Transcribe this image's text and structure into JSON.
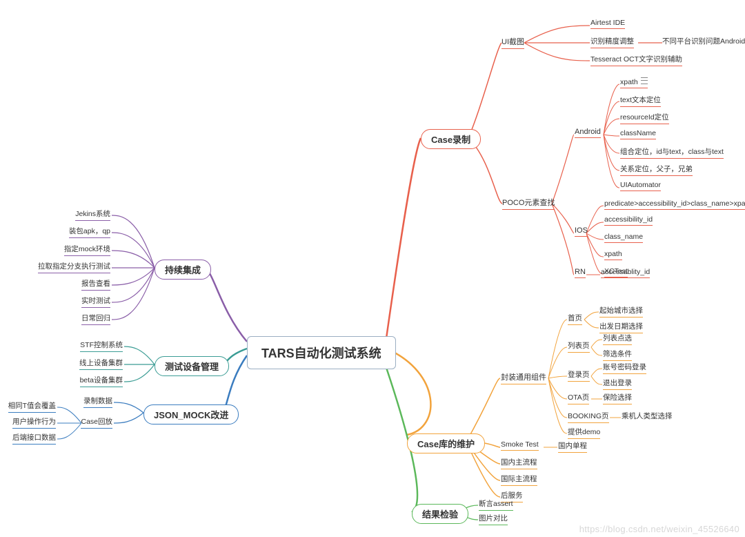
{
  "root": "TARS自动化测试系统",
  "watermark": "https://blog.csdn.net/weixin_45526640",
  "branches": {
    "case_rec": {
      "label": "Case录制",
      "ui_shot": {
        "label": "UI截图",
        "items": [
          "Airtest IDE",
          "识别精度调整",
          "Tesseract OCT文字识别辅助"
        ],
        "note_for_1": "不同平台识别问题Android，ios不通用"
      },
      "poco": {
        "label": "POCO元素查找",
        "android": {
          "label": "Android",
          "items": [
            "xpath",
            "text文本定位",
            "resourceId定位",
            "className",
            "组合定位，id与text，class与text",
            "关系定位，父子，兄弟",
            "UIAutomator"
          ]
        },
        "ios": {
          "label": "IOS",
          "items": [
            "predicate>accessibility_id>class_name>xpath",
            "accessibility_id",
            "class_name",
            "xpath",
            "XCTest"
          ]
        },
        "rn": {
          "label": "RN",
          "item": "accessablity_id"
        }
      }
    },
    "case_lib": {
      "label": "Case库的维护",
      "common": {
        "label": "封装通用组件",
        "home": {
          "label": "首页",
          "items": [
            "起始城市选择",
            "出发日期选择"
          ]
        },
        "list": {
          "label": "列表页",
          "items": [
            "列表点选",
            "筛选条件"
          ]
        },
        "login": {
          "label": "登录页",
          "items": [
            "账号密码登录",
            "退出登录"
          ]
        },
        "ota": {
          "label": "OTA页",
          "items": [
            "保险选择"
          ]
        },
        "booking": {
          "label": "BOOKING页",
          "note": "乘机人类型选择"
        },
        "demo": "提供demo"
      },
      "smoke": {
        "label": "Smoke Test",
        "item": "国内单程"
      },
      "others": [
        "国内主流程",
        "国际主流程",
        "后服务"
      ]
    },
    "result": {
      "label": "结果检验",
      "items": [
        "断言assert",
        "图片对比"
      ]
    },
    "ci": {
      "label": "持续集成",
      "items": [
        "Jekins系统",
        "装包apk，qp",
        "指定mock环境",
        "拉取指定分支执行测试",
        "报告查看",
        "实时测试",
        "日常回归"
      ]
    },
    "device": {
      "label": "测试设备管理",
      "items": [
        "STF控制系统",
        "线上设备集群",
        "beta设备集群"
      ]
    },
    "json_mock": {
      "label": "JSON_MOCK改进",
      "record": "录制数据",
      "playback": {
        "label": "Case回放",
        "items": [
          "相同T值会覆盖",
          "用户操作行为",
          "后端接口数据"
        ]
      }
    }
  }
}
